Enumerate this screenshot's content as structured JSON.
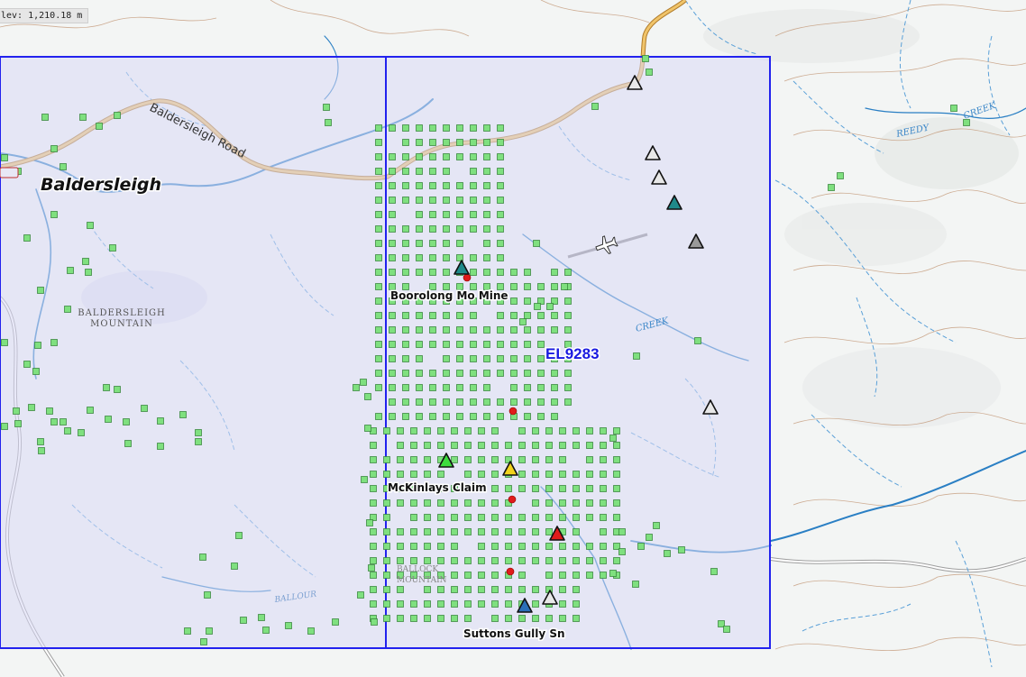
{
  "elevation_readout": "lev: 1,210.18 m",
  "labels": {
    "town": "Baldersleigh",
    "road": "Baldersleigh Road",
    "mountain_line1": "BALDERSLEIGH",
    "mountain_line2": "MOUNTAIN",
    "tenement": "EL9283",
    "creek_upper": "CREEK",
    "creek_reedy": "REEDY",
    "creek_ne": "CREEK",
    "mine_boorolong": "Boorolong Mo Mine",
    "claim_mckinlays": "McKinlays Claim",
    "mine_suttons": "Suttons Gully Sn",
    "south_label_1": "BALLOCK",
    "south_label_2": "MOUNTAIN",
    "south_river": "BALLOUR"
  },
  "colors": {
    "tenement_fill": "#dcdcf8",
    "tenement_border": "#2222ee",
    "sample_fill": "#7fe07f",
    "sample_stroke": "#2e7d32",
    "road": "#d4a24e",
    "water": "#2a7fc4",
    "contour": "#b88a6a",
    "triangle_white": "#e8e8e8",
    "triangle_grey": "#9a9a9a",
    "triangle_teal": "#1f8a8a",
    "triangle_green": "#3ddc3d",
    "triangle_yellow": "#f2d21c",
    "triangle_red": "#e01b1b",
    "triangle_blue": "#2a6fb8",
    "red_dot": "#e01b1b"
  },
  "icons": [
    "airplane-icon",
    "road-shield-icon"
  ]
}
